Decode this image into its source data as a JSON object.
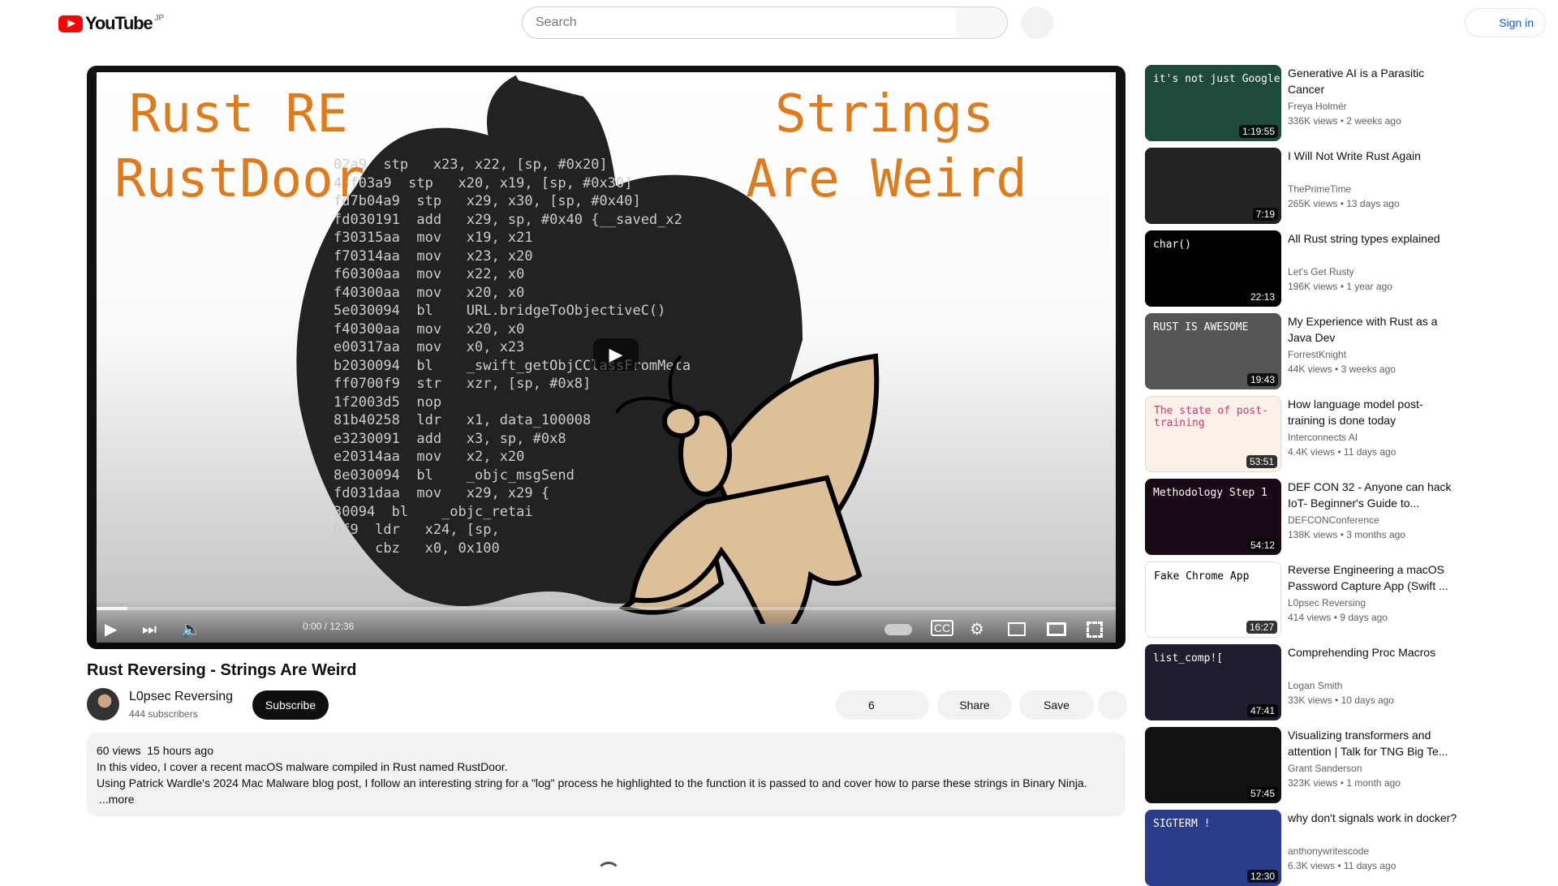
{
  "header": {
    "logo_text": "YouTube",
    "country": "JP",
    "search_placeholder": "Search",
    "sign_in": "Sign in"
  },
  "video": {
    "thumbnail_text": {
      "left_line1": "Rust RE",
      "left_line2": "RustDoor",
      "right_line1": "Strings",
      "right_line2": "Are Weird"
    },
    "code_lines": [
      "02a9  stp   x23, x22, [sp, #0x20]",
      "44f03a9  stp   x20, x19, [sp, #0x30]",
      "fd7b04a9  stp   x29, x30, [sp, #0x40]",
      "fd030191  add   x29, sp, #0x40 {__saved_x2",
      "f30315aa  mov   x19, x21",
      "f70314aa  mov   x23, x20",
      "f60300aa  mov   x22, x0",
      "f40300aa  mov   x20, x0",
      "5e030094  bl    URL.bridgeToObjectiveC()",
      "f40300aa  mov   x20, x0",
      "e00317aa  mov   x0, x23",
      "b2030094  bl    _swift_getObjCClassFromMeta",
      "ff0700f9  str   xzr, [sp, #0x8]",
      "1f2003d5  nop",
      "81b40258  ldr   x1, data_100008",
      "e3230091  add   x3, sp, #0x8",
      "e20314aa  mov   x2, x20",
      "8e030094  bl    _objc_msgSend",
      "fd031daa  mov   x29, x29 {",
      "30094  bl    _objc_retai",
      "0f9  ldr   x24, [sp,",
      "     cbz   x0, 0x100"
    ],
    "time_current": "0:00",
    "time_total": "12:36",
    "progress_percent": 0,
    "title": "Rust Reversing - Strings Are Weird",
    "channel": {
      "name": "L0psec Reversing",
      "subscribers": "444 subscribers",
      "subscribe_label": "Subscribe"
    },
    "actions": {
      "likes": "6",
      "share": "Share",
      "save": "Save"
    },
    "description": {
      "views": "60 views",
      "age": "15 hours ago",
      "line1": "In this video, I cover a recent macOS malware compiled in Rust named RustDoor.",
      "line2": "Using Patrick Wardle's 2024 Mac Malware blog post, I follow an interesting string for a \"log\" process he highlighted to the function it is passed to and cover how to parse these strings in Binary Ninja.",
      "more": "...more"
    }
  },
  "sidebar": [
    {
      "title": "Generative AI is a Parasitic Cancer",
      "channel": "Freya Holmér",
      "views": "336K views",
      "age": "2 weeks ago",
      "duration": "1:19:55",
      "thumb_text": "it's not just Google",
      "bg": "#1d4a3a"
    },
    {
      "title": "I Will Not Write Rust Again",
      "channel": "ThePrimeTime",
      "views": "265K views",
      "age": "13 days ago",
      "duration": "7:19",
      "thumb_text": "",
      "bg": "#222"
    },
    {
      "title": "All Rust string types explained",
      "channel": "Let's Get Rusty",
      "views": "196K views",
      "age": "1 year ago",
      "duration": "22:13",
      "thumb_text": "char()",
      "bg": "#000"
    },
    {
      "title": "My Experience with Rust as a Java Dev",
      "channel": "ForrestKnight",
      "views": "44K views",
      "age": "3 weeks ago",
      "duration": "19:43",
      "thumb_text": "RUST IS AWESOME",
      "bg": "#555"
    },
    {
      "title": "How language model post-training is done today",
      "channel": "Interconnects AI",
      "views": "4.4K views",
      "age": "11 days ago",
      "duration": "53:51",
      "thumb_text": "The state of post-training",
      "bg": "#fbf1e8"
    },
    {
      "title": "DEF CON 32 - Anyone can hack IoT- Beginner's Guide to...",
      "channel": "DEFCONConference",
      "views": "138K views",
      "age": "3 months ago",
      "duration": "54:12",
      "thumb_text": "Methodology Step 1",
      "bg": "#1a0a18"
    },
    {
      "title": "Reverse Engineering a macOS Password Capture App (Swift ...",
      "channel": "L0psec Reversing",
      "views": "414 views",
      "age": "9 days ago",
      "duration": "16:27",
      "thumb_text": "Fake Chrome App",
      "bg": "#fff"
    },
    {
      "title": "Comprehending Proc Macros",
      "channel": "Logan Smith",
      "views": "33K views",
      "age": "10 days ago",
      "duration": "47:41",
      "thumb_text": "list_comp![",
      "bg": "#1e1e2e"
    },
    {
      "title": "Visualizing transformers and attention | Talk for TNG Big Te...",
      "channel": "Grant Sanderson",
      "views": "323K views",
      "age": "1 month ago",
      "duration": "57:45",
      "thumb_text": "",
      "bg": "#111"
    },
    {
      "title": "why don't signals work in docker?",
      "channel": "anthonywritescode",
      "views": "6.3K views",
      "age": "11 days ago",
      "duration": "12:30",
      "thumb_text": "SIGTERM !",
      "bg": "#2a3c8a"
    }
  ],
  "colors": {
    "accent_orange": "#e07b1c",
    "youtube_red": "#ff0000",
    "link_blue": "#065fd4"
  }
}
